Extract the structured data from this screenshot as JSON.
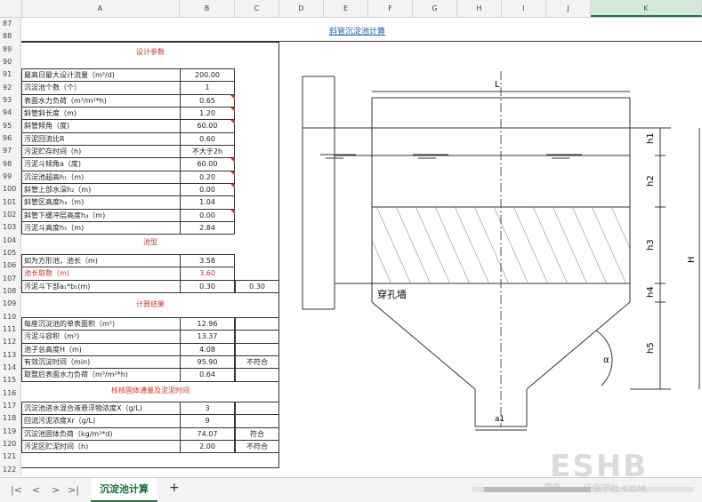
{
  "columns": [
    "A",
    "B",
    "C",
    "D",
    "E",
    "F",
    "G",
    "H",
    "I",
    "J",
    "K"
  ],
  "selected_column": "K",
  "row_numbers": [
    "87",
    "88",
    "89",
    "90",
    "91",
    "92",
    "93",
    "94",
    "95",
    "96",
    "97",
    "98",
    "99",
    "100",
    "101",
    "102",
    "103",
    "104",
    "105",
    "106",
    "107",
    "108",
    "109",
    "110",
    "111",
    "112",
    "113",
    "114",
    "115",
    "116",
    "117",
    "118",
    "119",
    "120",
    "121",
    "122"
  ],
  "sheet_title": "斜管沉淀池计算",
  "sections": {
    "design": "设计参数",
    "pool": "池型",
    "result": "计算结果",
    "check": "核核固体通量及泥泥时间"
  },
  "design_params": [
    {
      "label": "最高日最大设计流量（m³/d)",
      "value": "200.00"
    },
    {
      "label": "沉淀池个数（个）",
      "value": "1"
    },
    {
      "label": "表面水力负荷（m³/m²*h)",
      "value": "0.65"
    },
    {
      "label": "斜管斜长度（m)",
      "value": "1.20"
    },
    {
      "label": "斜管倾角（度)",
      "value": "60.00"
    },
    {
      "label": "污泥回流比R",
      "value": "0.60"
    },
    {
      "label": "污泥贮存时间（h)",
      "value": "不大于2h"
    },
    {
      "label": "污泥斗倾角a（度)",
      "value": "60.00"
    },
    {
      "label": "沉淀池超高h₁（m)",
      "value": "0.20"
    },
    {
      "label": "斜管上部水深h₂（m)",
      "value": "0.00"
    },
    {
      "label": "斜管区高度h₃（m)",
      "value": "1.04"
    },
    {
      "label": "斜管下缓冲层高度h₄（m)",
      "value": "0.00"
    },
    {
      "label": "污泥斗高度h₅（m)",
      "value": "2.84"
    }
  ],
  "pool_params": [
    {
      "label": "如为方形池，池长（m)",
      "value": "3.58"
    },
    {
      "label": "池长取数（m)",
      "value": "3.60"
    },
    {
      "label": "污泥斗下部a₁*b₁(m)",
      "value": "0.30",
      "value2": "0.30"
    }
  ],
  "results": [
    {
      "label": "每座沉淀池的单表面积（m²)",
      "value": "12.96",
      "note": ""
    },
    {
      "label": "污泥斗容积（m³)",
      "value": "13.37",
      "note": ""
    },
    {
      "label": "池子总高度H（m)",
      "value": "4.08",
      "note": ""
    },
    {
      "label": "有效沉淀时间（min)",
      "value": "95.90",
      "note": "不符合"
    },
    {
      "label": "取整后表面水力负荷（m³/m²*h)",
      "value": "0.64",
      "note": ""
    }
  ],
  "check_params": [
    {
      "label": "沉淀池进水混合液悬浮物浓度X（g/L)",
      "value": "3",
      "note": ""
    },
    {
      "label": "回流污泥浓度Xr（g/L)",
      "value": "9",
      "note": ""
    },
    {
      "label": "沉淀池固体负荷（kg/m²*d)",
      "value": "74.07",
      "note": "符合"
    },
    {
      "label": "污泥区贮泥时间（h)",
      "value": "2.00",
      "note": "不符合"
    }
  ],
  "diagram_labels": {
    "L": "L",
    "h1": "h1",
    "h2": "h2",
    "h3": "h3",
    "h4": "h4",
    "h5": "h5",
    "H": "H",
    "alpha": "α",
    "a1": "a1",
    "wall": "穿孔墙"
  },
  "sheet_tab": "沉淀池计算",
  "add_sheet": "+",
  "nav": [
    "|<",
    "<",
    ">",
    ">|"
  ],
  "watermark": {
    "logo": "ESHB",
    "site": "环保学社·COM",
    "tag": "微信"
  }
}
